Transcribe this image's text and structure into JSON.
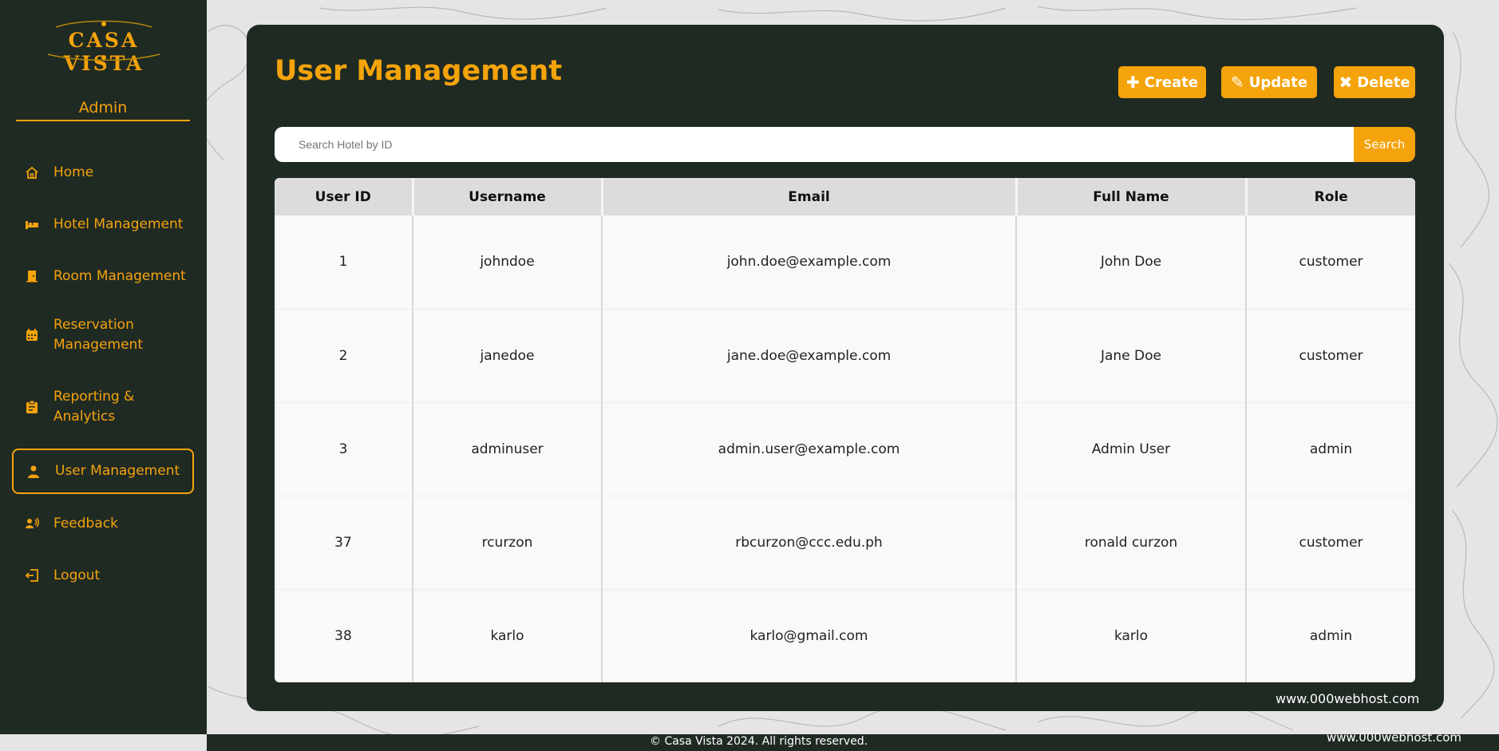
{
  "brand": {
    "logo_text": "CASA VISTA"
  },
  "sidebar": {
    "role": "Admin",
    "items": [
      {
        "label": "Home",
        "icon": "home-icon"
      },
      {
        "label": "Hotel Management",
        "icon": "bed-icon"
      },
      {
        "label": "Room Management",
        "icon": "door-icon"
      },
      {
        "label": "Reservation Management",
        "icon": "calendar-icon"
      },
      {
        "label": "Reporting & Analytics",
        "icon": "clipboard-icon"
      },
      {
        "label": "User Management",
        "icon": "user-icon",
        "active": true
      },
      {
        "label": "Feedback",
        "icon": "voice-feedback-icon"
      },
      {
        "label": "Logout",
        "icon": "logout-icon"
      }
    ]
  },
  "main": {
    "title": "User Management",
    "actions": {
      "create": "Create",
      "update": "Update",
      "delete": "Delete"
    },
    "search": {
      "placeholder": "Search Hotel by ID",
      "button": "Search"
    },
    "table": {
      "headers": [
        "User ID",
        "Username",
        "Email",
        "Full Name",
        "Role"
      ],
      "rows": [
        [
          "1",
          "johndoe",
          "john.doe@example.com",
          "John Doe",
          "customer"
        ],
        [
          "2",
          "janedoe",
          "jane.doe@example.com",
          "Jane Doe",
          "customer"
        ],
        [
          "3",
          "adminuser",
          "admin.user@example.com",
          "Admin User",
          "admin"
        ],
        [
          "37",
          "rcurzon",
          "rbcurzon@ccc.edu.ph",
          "ronald curzon",
          "customer"
        ],
        [
          "38",
          "karlo",
          "karlo@gmail.com",
          "karlo",
          "admin"
        ]
      ]
    }
  },
  "footer": {
    "text": "© Casa Vista 2024. All rights reserved."
  },
  "host_badges": [
    "www.000webhost.com",
    "www.000webhost.com"
  ],
  "colors": {
    "accent": "#f5a30b",
    "dark": "#1f2a23",
    "table_bg": "#f9f9f7",
    "header_bg": "#dcdcdc"
  }
}
